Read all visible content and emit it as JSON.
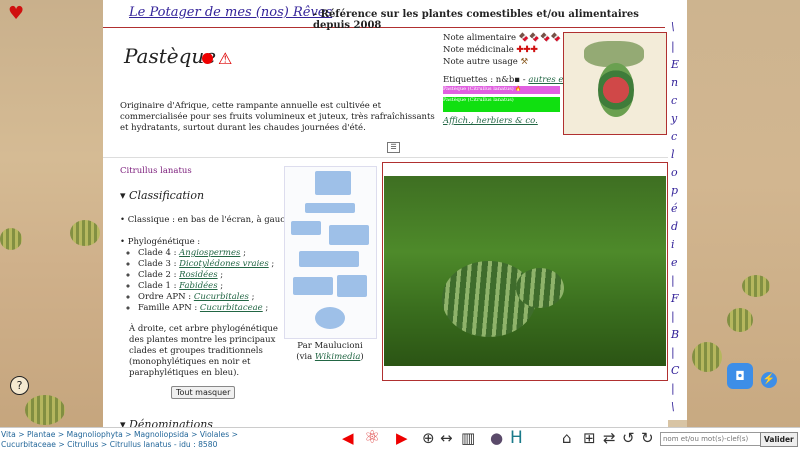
{
  "header": {
    "site_title": "Le Potager de mes (nos) Rêves",
    "site_subtitle": " - Référence sur les plantes comestibles et/ou alimentaires depuis 2008"
  },
  "plant": {
    "name": "Pastèque",
    "intro": "Originaire d'Afrique, cette rampante annuelle est cultivée et commercialisée pour ses fruits volumineux et juteux, très rafraîchissants et hydratants, surtout durant les chaudes journées d'été.",
    "latin": "Citrullus lanatus"
  },
  "notes": {
    "food": "Note alimentaire",
    "food_icons": "🍫🍫🍫🍫",
    "medical": "Note médicinale",
    "medical_icons": "✚✚✚",
    "other": "Note autre usage",
    "other_icons": "⚒",
    "tags_label": "Etiquettes : n&b",
    "tags_sep": " - ",
    "tags_link": "autres ex.",
    "tag1": "Pastèque (Citrullus lanatus) 🔥",
    "tag2": "Pastèque (Citrullus lanatus)",
    "affich": "Affich., herbiers & co."
  },
  "classification": {
    "heading": "Classification",
    "classic": "Classique : en bas de l'écran, à gauche.",
    "phylo_label": "Phylogénétique :",
    "clades": [
      {
        "prefix": "Clade 4 : ",
        "link": "Angiospermes",
        "suffix": " ;"
      },
      {
        "prefix": "Clade 3 : ",
        "link": "Dicotylédones vraies",
        "suffix": " ;"
      },
      {
        "prefix": "Clade 2 : ",
        "link": "Rosidées",
        "suffix": " ;"
      },
      {
        "prefix": "Clade 1 : ",
        "link": "Fabidées",
        "suffix": " ;"
      },
      {
        "prefix": "Ordre APN : ",
        "link": "Cucurbitales",
        "suffix": " ;"
      },
      {
        "prefix": "Famille APN : ",
        "link": "Cucurbitaceae",
        "suffix": " ;"
      }
    ],
    "adroite": "À droite, cet arbre phylogénétique des plantes montre les principaux clades et groupes traditionnels (monophylétiques en noir et paraphylétiques en bleu).",
    "hide_button": "Tout masquer",
    "denominations": "Dénominations"
  },
  "credit": {
    "by": "Par Maulucioni",
    "via_prefix": "(via ",
    "via_link": "Wikimedia",
    "via_suffix": ")"
  },
  "encyclopedie": [
    "\\",
    "|",
    "E",
    "n",
    "c",
    "y",
    "c",
    "l",
    "o",
    "p",
    "é",
    "d",
    "i",
    "e",
    "|",
    "F",
    "|",
    "B",
    "|",
    "C",
    "|",
    "\\"
  ],
  "breadcrumb": {
    "line1": [
      "Vita",
      " > ",
      "Plantae",
      " > ",
      "Magnoliophyta",
      " > ",
      "Magnoliopsida",
      " > ",
      "Violales",
      " >"
    ],
    "line2": [
      "Cucurbitaceae",
      " > ",
      "Citrullus",
      " > ",
      "Citrullus lanatus"
    ],
    "idu": " - idu : 8580"
  },
  "search": {
    "placeholder": "nom et/ou mot(s)-clef(s)",
    "submit": "Valider"
  },
  "colors": {
    "accent": "#332299",
    "link": "#226644",
    "border": "#b03030"
  }
}
